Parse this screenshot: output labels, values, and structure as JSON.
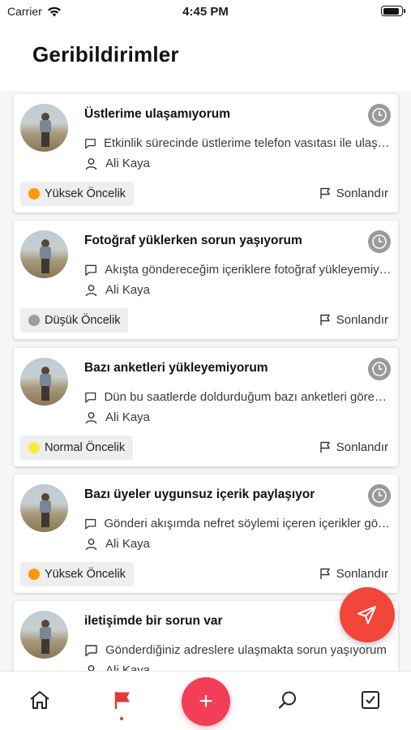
{
  "status_bar": {
    "carrier": "Carrier",
    "time": "4:45 PM"
  },
  "header": {
    "title": "Geribildirimler"
  },
  "feedbacks": [
    {
      "title": "Üstlerime ulaşamıyorum",
      "description": "Etkinlik sürecinde üstlerime telefon vasıtası ile ulaşamıyorum",
      "user": "Ali Kaya",
      "priority": "Yüksek Öncelik",
      "priority_color": "#ff9800",
      "action": "Sonlandır"
    },
    {
      "title": "Fotoğraf yüklerken sorun yaşıyorum",
      "description": "Akışta göndereceğim içeriklere fotoğraf yükleyemiyorum",
      "user": "Ali Kaya",
      "priority": "Düşük Öncelik",
      "priority_color": "#9e9e9e",
      "action": "Sonlandır"
    },
    {
      "title": "Bazı anketleri yükleyemiyorum",
      "description": "Dün bu saatlerde doldurduğum bazı anketleri göremiyorum",
      "user": "Ali Kaya",
      "priority": "Normal Öncelik",
      "priority_color": "#ffeb3b",
      "action": "Sonlandır"
    },
    {
      "title": "Bazı üyeler uygunsuz içerik paylaşıyor",
      "description": "Gönderi akışımda nefret söylemi içeren içerikler görüyorum",
      "user": "Ali Kaya",
      "priority": "Yüksek Öncelik",
      "priority_color": "#ff9800",
      "action": "Sonlandır"
    },
    {
      "title": "iletişimde bir sorun var",
      "description": "Gönderdiğiniz adreslere ulaşmakta sorun yaşıyorum",
      "user": "Ali Kaya",
      "priority": "",
      "priority_color": "",
      "action": ""
    }
  ],
  "fab": {
    "icon": "send-icon",
    "color": "#f2463a"
  },
  "tabbar": {
    "items": [
      {
        "icon": "home-icon"
      },
      {
        "icon": "flag-icon",
        "active": true
      },
      {
        "icon": "add-icon",
        "label": "+"
      },
      {
        "icon": "search-icon"
      },
      {
        "icon": "checkbox-icon"
      }
    ],
    "accent": "#e53935"
  }
}
